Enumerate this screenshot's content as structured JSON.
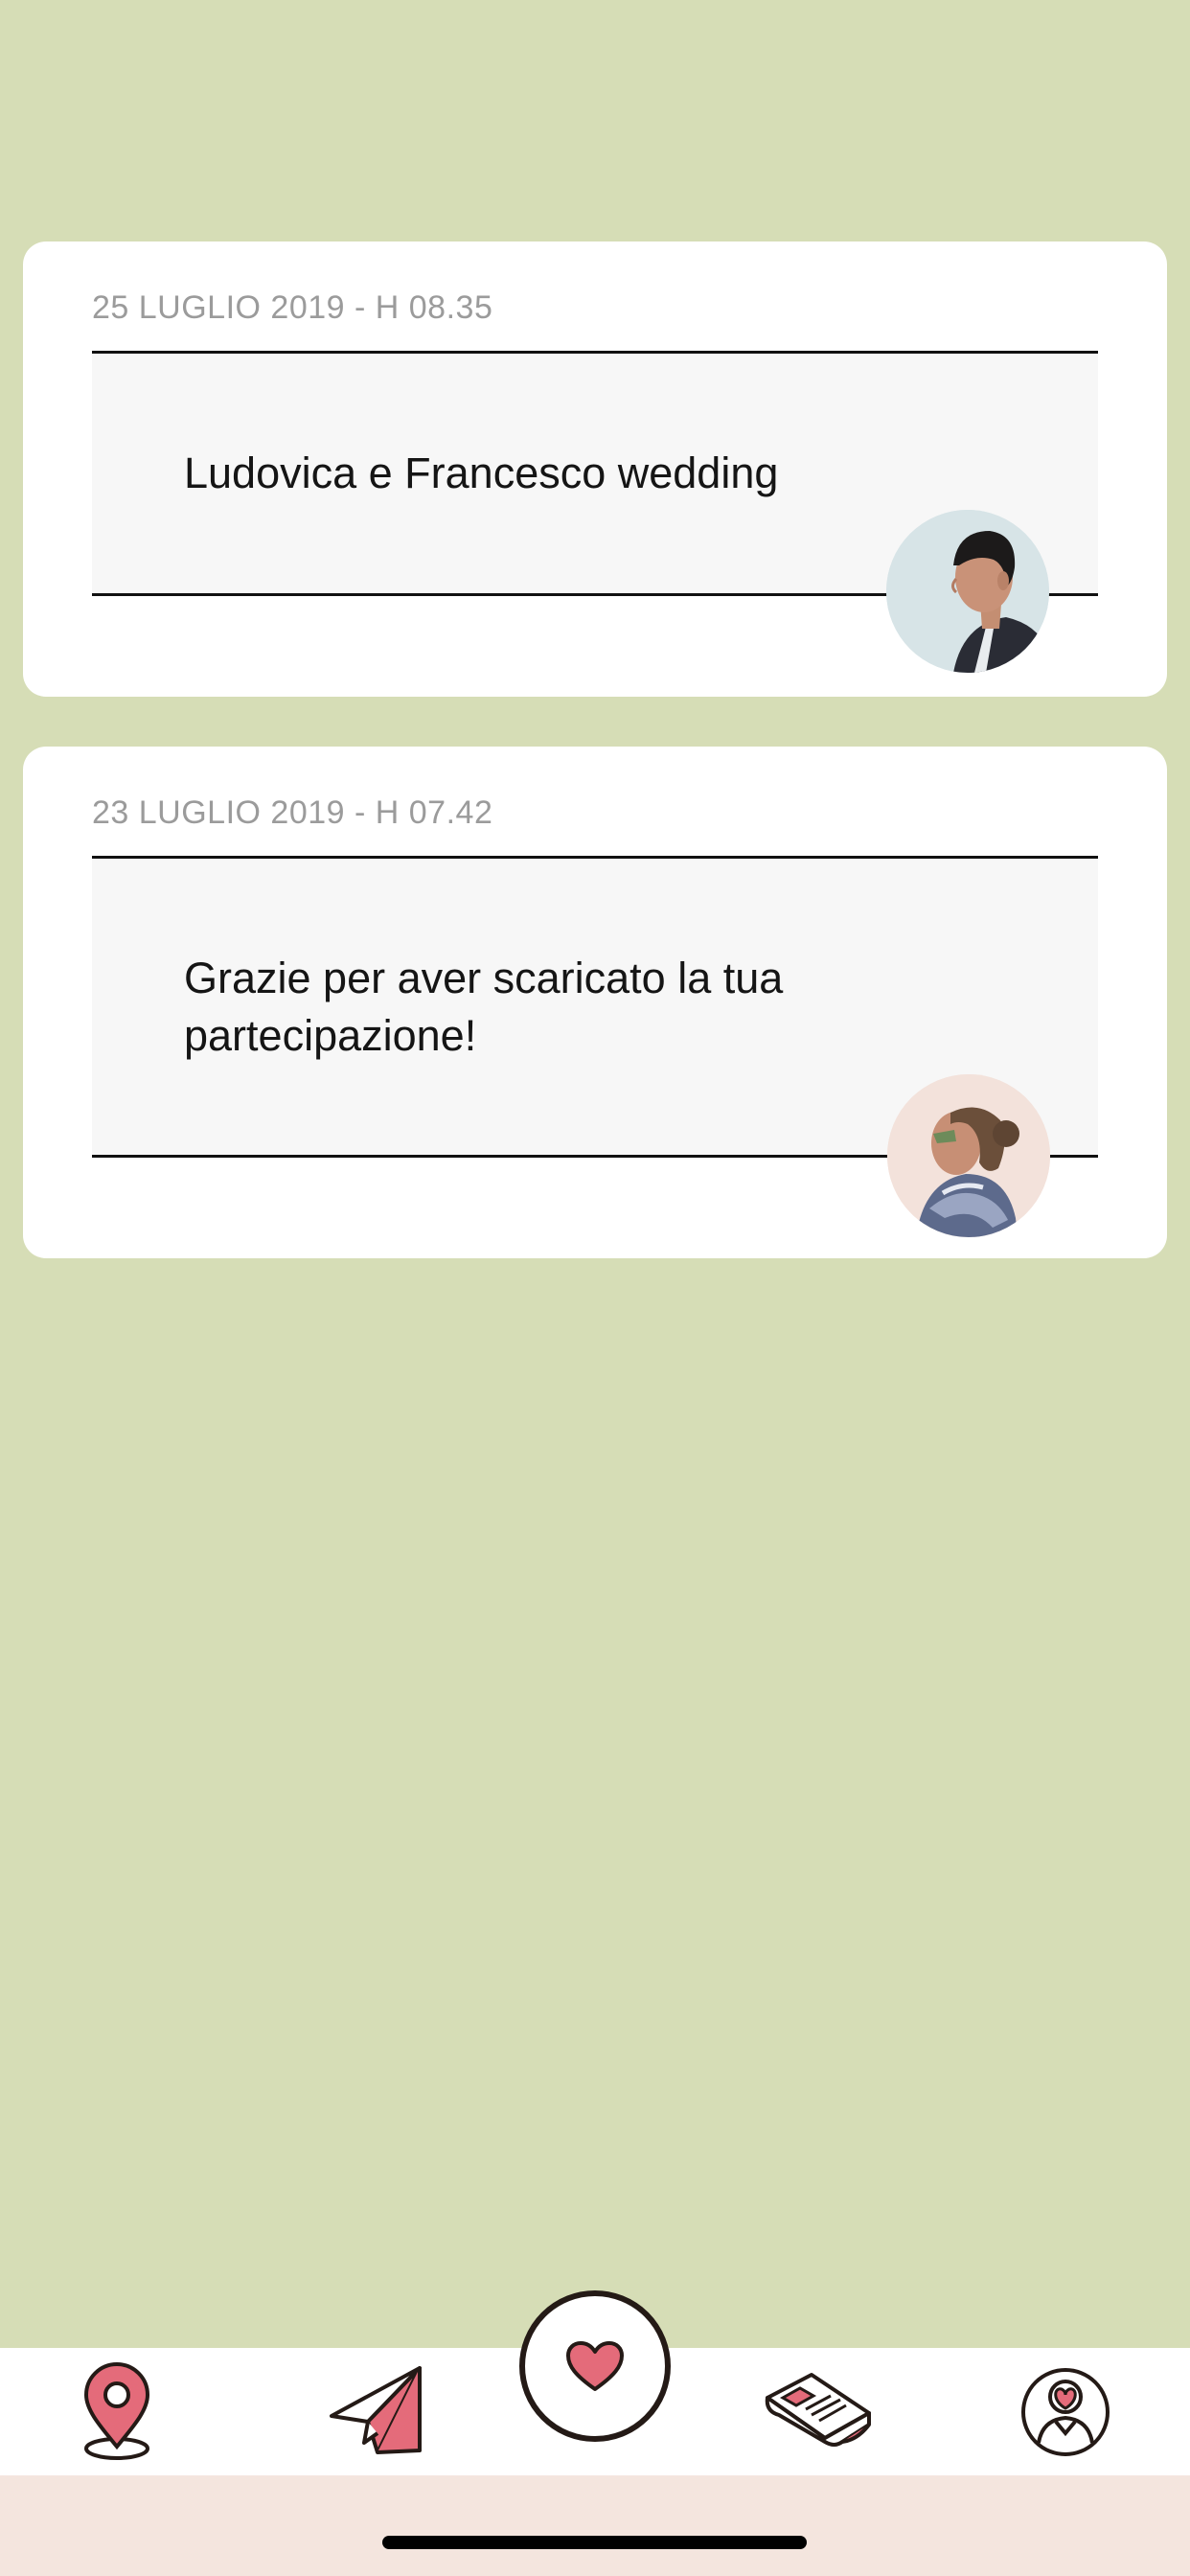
{
  "notifications": [
    {
      "date": "25 LUGLIO 2019 - H 08.35",
      "message": "Ludovica e Francesco wedding",
      "avatar": "man-profile-avatar"
    },
    {
      "date": "23 LUGLIO 2019 - H 07.42",
      "message": "Grazie per aver scaricato la tua partecipazione!",
      "avatar": "woman-profile-avatar"
    }
  ],
  "tab_bar": {
    "items": [
      {
        "icon": "map-pin-icon"
      },
      {
        "icon": "paper-plane-icon"
      },
      {
        "icon": "heart-icon",
        "active": true
      },
      {
        "icon": "newspaper-icon"
      },
      {
        "icon": "couple-profile-icon"
      }
    ]
  },
  "colors": {
    "background": "#d6ddb6",
    "card": "#ffffff",
    "panel": "#f7f7f7",
    "accent_pink": "#e46b7a",
    "outline": "#241a16",
    "date_gray": "#9b9b9b",
    "home_area": "#f4e5de"
  }
}
